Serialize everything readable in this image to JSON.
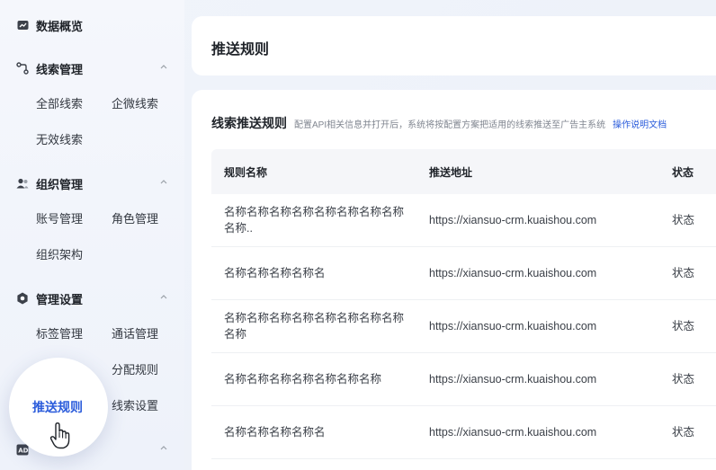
{
  "sidebar": {
    "overview": {
      "label": "数据概览",
      "icon": "dashboard-icon"
    },
    "leads": {
      "label": "线索管理",
      "icon": "flow-icon",
      "items": [
        "全部线索",
        "企微线索",
        "无效线索"
      ]
    },
    "org": {
      "label": "组织管理",
      "icon": "users-icon",
      "items": [
        "账号管理",
        "角色管理",
        "组织架构"
      ]
    },
    "settings": {
      "label": "管理设置",
      "icon": "gear-icon",
      "items": [
        "标签管理",
        "通话管理",
        "分配规则",
        "推送规则",
        "线索设置"
      ],
      "active": "推送规则"
    },
    "ad": {
      "icon": "ad-icon"
    }
  },
  "header": {
    "title": "推送规则"
  },
  "main": {
    "section_title": "线索推送规则",
    "section_desc": "配置API相关信息并打开后，系统将按配置方案把适用的线索推送至广告主系统",
    "doc_link": "操作说明文档",
    "columns": [
      "规则名称",
      "推送地址",
      "状态"
    ],
    "rows": [
      {
        "name": "名称名称名称名称名称名称名称名称名称..",
        "url": "https://xiansuo-crm.kuaishou.com",
        "status": "状态"
      },
      {
        "name": "名称名称名称名称名",
        "url": "https://xiansuo-crm.kuaishou.com",
        "status": "状态"
      },
      {
        "name": "名称名称名称名称名称名称名称名称名称",
        "url": "https://xiansuo-crm.kuaishou.com",
        "status": "状态"
      },
      {
        "name": "名称名称名称名称名称名称名称",
        "url": "https://xiansuo-crm.kuaishou.com",
        "status": "状态"
      },
      {
        "name": "名称名称名称名称名",
        "url": "https://xiansuo-crm.kuaishou.com",
        "status": "状态"
      }
    ]
  },
  "colors": {
    "accent": "#2b5cdb",
    "text": "#1f2329",
    "muted": "#808690"
  }
}
